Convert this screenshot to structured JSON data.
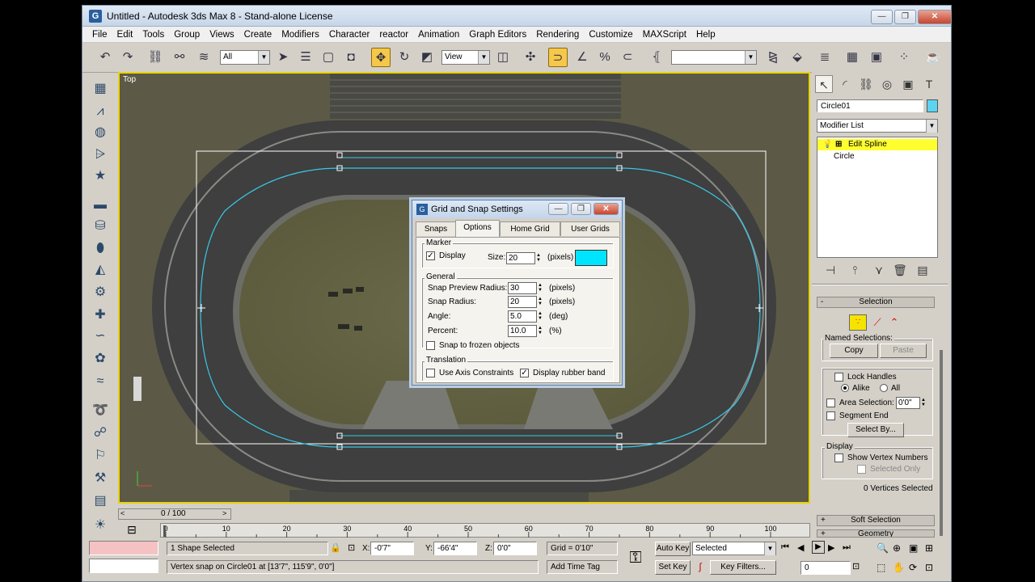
{
  "window": {
    "title": "Untitled - Autodesk 3ds Max 8  - Stand-alone License",
    "minimize": "—",
    "restore": "❐",
    "close": "✕"
  },
  "menu": [
    "File",
    "Edit",
    "Tools",
    "Group",
    "Views",
    "Create",
    "Modifiers",
    "Character",
    "reactor",
    "Animation",
    "Graph Editors",
    "Rendering",
    "Customize",
    "MAXScript",
    "Help"
  ],
  "toolbar": {
    "selection_filter": "All",
    "ref_coord": "View",
    "named_sel": ""
  },
  "viewport": {
    "label": "Top",
    "spline_color": "#39c7e6",
    "border_color": "#e8d30a"
  },
  "command_panel": {
    "object_name": "Circle01",
    "object_color": "#5ad4f0",
    "modifier_list": "Modifier List",
    "stack": [
      {
        "label": "Edit Spline",
        "active": true
      },
      {
        "label": "Circle",
        "active": false
      }
    ],
    "selection_rollout": "Selection",
    "named_selections": "Named Selections:",
    "copy": "Copy",
    "paste": "Paste",
    "lock_handles": "Lock Handles",
    "alike": "Alike",
    "all": "All",
    "area_selection": "Area Selection:",
    "area_value": "0'0\"",
    "segment_end": "Segment End",
    "select_by": "Select By...",
    "display_group": "Display",
    "show_vertex_numbers": "Show Vertex Numbers",
    "selected_only": "Selected Only",
    "vertices_selected": "0 Vertices Selected",
    "soft_selection": "Soft Selection",
    "geometry": "Geometry",
    "minus": "-",
    "plus": "+"
  },
  "dialog": {
    "title": "Grid and Snap Settings",
    "tabs": [
      "Snaps",
      "Options",
      "Home Grid",
      "User Grids"
    ],
    "active_tab": "Options",
    "marker_group": "Marker",
    "display": "Display",
    "size_label": "Size:",
    "size_value": "20",
    "pixels": "(pixels)",
    "marker_color": "#00e5ff",
    "general_group": "General",
    "snap_preview_radius": "Snap Preview Radius:",
    "snap_preview_value": "30",
    "snap_radius": "Snap Radius:",
    "snap_radius_value": "20",
    "angle": "Angle:",
    "angle_value": "5.0",
    "deg": "(deg)",
    "percent": "Percent:",
    "percent_value": "10.0",
    "pct": "(%)",
    "snap_frozen": "Snap to frozen objects",
    "translation_group": "Translation",
    "use_axis": "Use Axis Constraints",
    "rubber_band": "Display rubber band"
  },
  "timeline": {
    "frame": "0 / 100",
    "ticks": [
      "0",
      "10",
      "20",
      "30",
      "40",
      "50",
      "60",
      "70",
      "80",
      "90",
      "100"
    ]
  },
  "status": {
    "selected": "1 Shape Selected",
    "prompt": "Vertex snap on Circle01 at [13'7\", 115'9\", 0'0\"]",
    "x_label": "X:",
    "x": "-0'7\"",
    "y_label": "Y:",
    "y": "-66'4\"",
    "z_label": "Z:",
    "z": "0'0\"",
    "grid": "Grid = 0'10\"",
    "add_time_tag": "Add Time Tag",
    "auto_key": "Auto Key",
    "set_key": "Set Key",
    "key_mode": "Selected",
    "key_filters": "Key Filters...",
    "frame_field": "0"
  }
}
